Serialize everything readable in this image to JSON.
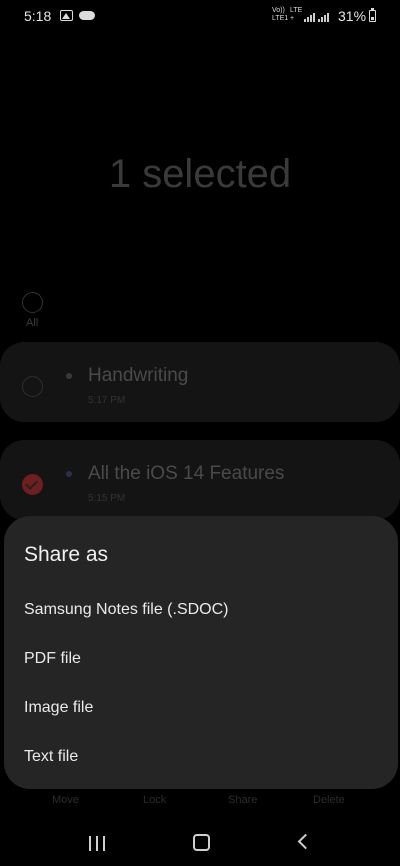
{
  "status_bar": {
    "time": "5:18",
    "volte": "Vo))\nLTE1",
    "lte": "LTE\n+",
    "battery": "31%"
  },
  "header": {
    "title": "1 selected"
  },
  "select_all": {
    "label": "All"
  },
  "notes": [
    {
      "title": "Handwriting",
      "time": "5:17 PM",
      "selected": false
    },
    {
      "title": "All the iOS 14 Features",
      "time": "5:15 PM",
      "selected": true
    }
  ],
  "share_sheet": {
    "title": "Share as",
    "options": [
      "Samsung Notes file (.SDOC)",
      "PDF file",
      "Image file",
      "Text file"
    ]
  },
  "action_bar": [
    "Move",
    "Lock",
    "Share",
    "Delete"
  ],
  "icons": {
    "gallery": "gallery-icon",
    "cloud": "cloud-icon",
    "signal": "signal-icon",
    "battery": "battery-icon",
    "recents": "recents-icon",
    "home": "home-icon",
    "back": "back-icon"
  }
}
